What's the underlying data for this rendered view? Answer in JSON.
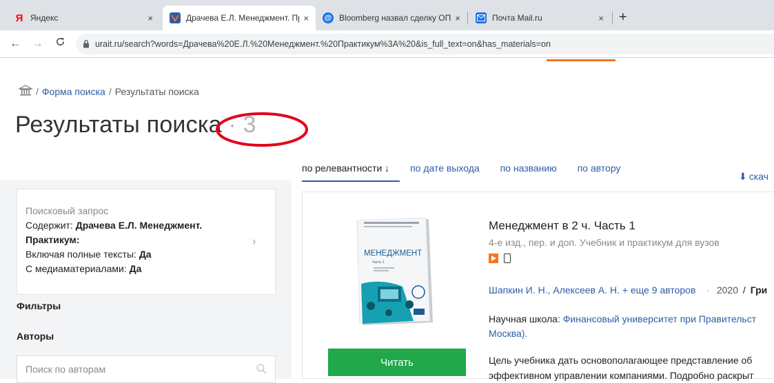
{
  "browser": {
    "tabs": [
      {
        "label": "Яндекс",
        "icon": "yandex-icon",
        "close": "×"
      },
      {
        "label": "Драчева Е.Л. Менеджмент. Пра",
        "icon": "urait-icon",
        "close": "×"
      },
      {
        "label": "Bloomberg назвал сделку ОПЕК",
        "icon": "mailru-icon",
        "close": "×"
      },
      {
        "label": "Почта Mail.ru",
        "icon": "mail-icon",
        "close": "×"
      }
    ],
    "new_tab": "+",
    "url": "urait.ru/search?words=Драчева%20Е.Л.%20Менеджмент.%20Практикум%3A%20&is_full_text=on&has_materials=on"
  },
  "breadcrumb": {
    "sep1": "/",
    "item1": "Форма поиска",
    "sep2": "/",
    "item2": "Результаты поиска"
  },
  "page": {
    "title": "Результаты поиска",
    "count_sep": " · ",
    "count": "3"
  },
  "sort": {
    "options": [
      "по релевантности ↓",
      "по дате выхода",
      "по названию",
      "по автору"
    ],
    "download": "скач"
  },
  "query": {
    "label": "Поисковый запрос",
    "contains_label": "Содержит:",
    "contains_value_1": "Драчева Е.Л. Менеджмент.",
    "contains_value_2": "Практикум:",
    "fulltext_label": "Включая полные тексты:",
    "fulltext_value": "Да",
    "media_label": "С медиаматериалами:",
    "media_value": "Да"
  },
  "filters": {
    "title": "Фильтры",
    "authors_title": "Авторы",
    "author_search_placeholder": "Поиск по авторам"
  },
  "book": {
    "cover_title": "МЕНЕДЖМЕНТ",
    "cover_part": "Часть 1",
    "title": "Менеджмент в 2 ч. Часть 1",
    "subtitle": "4-е изд., пер. и доп. Учебник и практикум для вузов",
    "authors": "Шапкин И. Н., Алексеев А. Н.",
    "more_authors": "+ еще 9 авторов",
    "dot": "·",
    "year": "2020",
    "slash": "/",
    "publisher": "Гри",
    "school_label": "Научная школа:",
    "school_value": "Финансовый университет при Правительст",
    "school_value_2": "Москва).",
    "desc_1": "Цель учебника дать основополагающее представление об",
    "desc_2": "эффективном управлении компаниями. Подробно раскрыт",
    "read_label": "Читать"
  }
}
